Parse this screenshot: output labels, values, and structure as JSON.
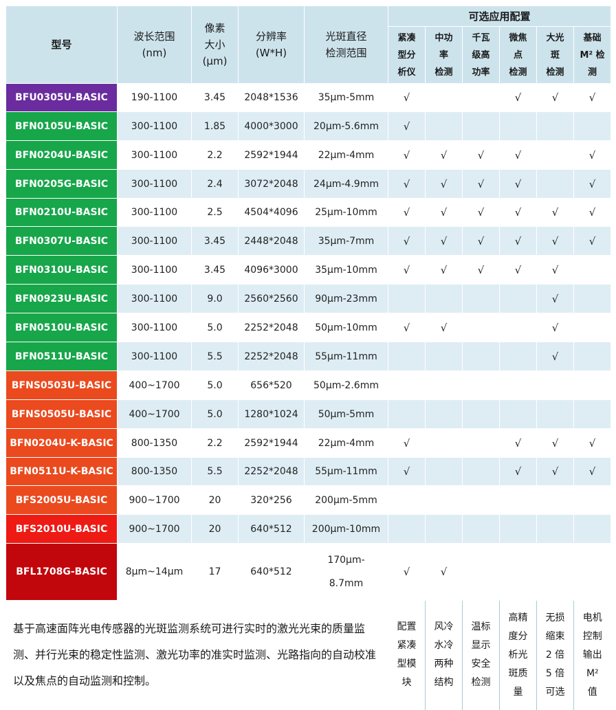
{
  "header": {
    "model": "型号",
    "wavelength": [
      "波长范围",
      "(nm)"
    ],
    "pixel": [
      "像素",
      "大小",
      "(μm)"
    ],
    "resolution": [
      "分辨率",
      "(W*H)"
    ],
    "spot": [
      "光斑直径",
      "检测范围"
    ],
    "optional_title": "可选应用配置",
    "features": [
      [
        "紧凑",
        "型分",
        "析仪"
      ],
      [
        "中功",
        "率",
        "检测"
      ],
      [
        "千瓦",
        "级高",
        "功率"
      ],
      [
        "微焦",
        "点",
        "检测"
      ],
      [
        "大光",
        "斑",
        "检测"
      ],
      [
        "基础",
        "M² 检",
        "测"
      ]
    ]
  },
  "check_mark": "√",
  "rows": [
    {
      "model": "BFU0305U-BASIC",
      "color": "#6a2c9f",
      "wavelength": "190-1100",
      "pixel": "3.45",
      "resolution": "2048*1536",
      "spot": "35μm-5mm",
      "checks": [
        1,
        0,
        0,
        1,
        1,
        1
      ]
    },
    {
      "model": "BFN0105U-BASIC",
      "color": "#17a64a",
      "wavelength": "300-1100",
      "pixel": "1.85",
      "resolution": "4000*3000",
      "spot": "20μm-5.6mm",
      "checks": [
        1,
        0,
        0,
        0,
        0,
        0
      ]
    },
    {
      "model": "BFN0204U-BASIC",
      "color": "#17a64a",
      "wavelength": "300-1100",
      "pixel": "2.2",
      "resolution": "2592*1944",
      "spot": "22μm-4mm",
      "checks": [
        1,
        1,
        1,
        1,
        0,
        1
      ]
    },
    {
      "model": "BFN0205G-BASIC",
      "color": "#17a64a",
      "wavelength": "300-1100",
      "pixel": "2.4",
      "resolution": "3072*2048",
      "spot": "24μm-4.9mm",
      "checks": [
        1,
        1,
        1,
        1,
        0,
        1
      ]
    },
    {
      "model": "BFN0210U-BASIC",
      "color": "#17a64a",
      "wavelength": "300-1100",
      "pixel": "2.5",
      "resolution": "4504*4096",
      "spot": "25μm-10mm",
      "checks": [
        1,
        1,
        1,
        1,
        1,
        1
      ]
    },
    {
      "model": "BFN0307U-BASIC",
      "color": "#17a64a",
      "wavelength": "300-1100",
      "pixel": "3.45",
      "resolution": "2448*2048",
      "spot": "35μm-7mm",
      "checks": [
        1,
        1,
        1,
        1,
        1,
        1
      ]
    },
    {
      "model": "BFN0310U-BASIC",
      "color": "#17a64a",
      "wavelength": "300-1100",
      "pixel": "3.45",
      "resolution": "4096*3000",
      "spot": "35μm-10mm",
      "checks": [
        1,
        1,
        1,
        1,
        1,
        0
      ]
    },
    {
      "model": "BFN0923U-BASIC",
      "color": "#17a64a",
      "wavelength": "300-1100",
      "pixel": "9.0",
      "resolution": "2560*2560",
      "spot": "90μm-23mm",
      "checks": [
        0,
        0,
        0,
        0,
        1,
        0
      ]
    },
    {
      "model": "BFN0510U-BASIC",
      "color": "#17a64a",
      "wavelength": "300-1100",
      "pixel": "5.0",
      "resolution": "2252*2048",
      "spot": "50μm-10mm",
      "checks": [
        1,
        1,
        0,
        0,
        1,
        0
      ]
    },
    {
      "model": "BFN0511U-BASIC",
      "color": "#17a64a",
      "wavelength": "300-1100",
      "pixel": "5.5",
      "resolution": "2252*2048",
      "spot": "55μm-11mm",
      "checks": [
        0,
        0,
        0,
        0,
        1,
        0
      ]
    },
    {
      "model": "BFNS0503U-BASIC",
      "color": "#ea4a1e",
      "wavelength": "400~1700",
      "pixel": "5.0",
      "resolution": "656*520",
      "spot": "50μm-2.6mm",
      "checks": [
        0,
        0,
        0,
        0,
        0,
        0
      ]
    },
    {
      "model": "BFNS0505U-BASIC",
      "color": "#ea4a1e",
      "wavelength": "400~1700",
      "pixel": "5.0",
      "resolution": "1280*1024",
      "spot": "50μm-5mm",
      "checks": [
        0,
        0,
        0,
        0,
        0,
        0
      ]
    },
    {
      "model": "BFN0204U-K-BASIC",
      "color": "#ea4a1e",
      "wavelength": "800-1350",
      "pixel": "2.2",
      "resolution": "2592*1944",
      "spot": "22μm-4mm",
      "checks": [
        1,
        0,
        0,
        1,
        1,
        1
      ]
    },
    {
      "model": "BFN0511U-K-BASIC",
      "color": "#ea4a1e",
      "wavelength": "800-1350",
      "pixel": "5.5",
      "resolution": "2252*2048",
      "spot": "55μm-11mm",
      "checks": [
        1,
        0,
        0,
        1,
        1,
        1
      ]
    },
    {
      "model": "BFS2005U-BASIC",
      "color": "#ea4a1e",
      "wavelength": "900~1700",
      "pixel": "20",
      "resolution": "320*256",
      "spot": "200μm-5mm",
      "checks": [
        0,
        0,
        0,
        0,
        0,
        0
      ]
    },
    {
      "model": "BFS2010U-BASIC",
      "color": "#ee1a14",
      "wavelength": "900~1700",
      "pixel": "20",
      "resolution": "640*512",
      "spot": "200μm-10mm",
      "checks": [
        0,
        0,
        0,
        0,
        0,
        0
      ]
    },
    {
      "model": "BFL1708G-BASIC",
      "color": "#c1060c",
      "wavelength": "8μm~14μm",
      "pixel": "17",
      "resolution": "640*512",
      "spot": [
        "170μm-",
        "8.7mm"
      ],
      "checks": [
        1,
        1,
        0,
        0,
        0,
        0
      ]
    }
  ],
  "footer": {
    "description": "基于高速面阵光电传感器的光斑监测系统可进行实时的激光光束的质量监测、并行光束的稳定性监测、激光功率的准实时监测、光路指向的自动校准以及焦点的自动监测和控制。",
    "features": [
      [
        "配置",
        "紧凑",
        "型模",
        "块"
      ],
      [
        "风冷",
        "水冷",
        "两种",
        "结构"
      ],
      [
        "温标",
        "显示",
        "安全",
        "检测"
      ],
      [
        "高精",
        "度分",
        "析光",
        "斑质",
        "量"
      ],
      [
        "无损",
        "缩束",
        "2 倍",
        "5 倍",
        "可选"
      ],
      [
        "电机",
        "控制",
        "输出",
        "M²",
        "值"
      ]
    ]
  }
}
